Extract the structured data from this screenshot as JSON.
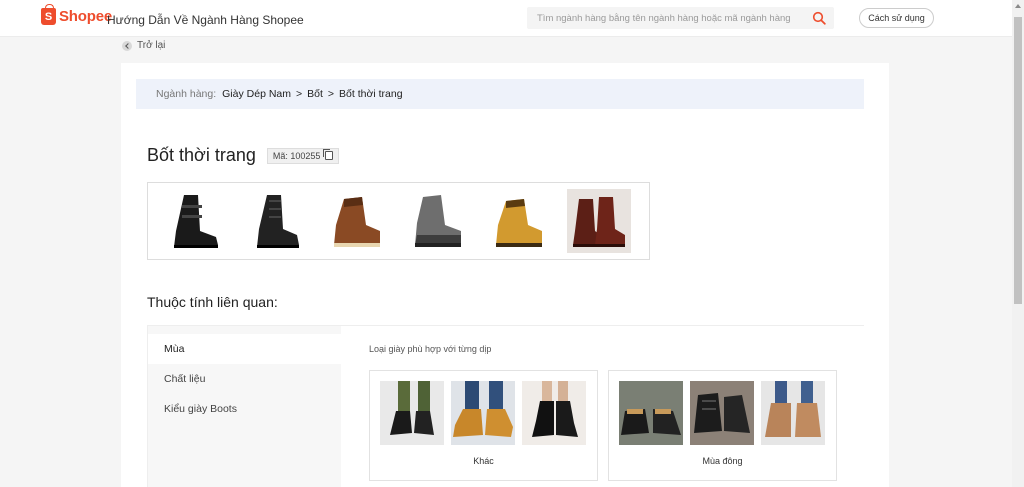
{
  "header": {
    "logo_text": "Shopee",
    "logo_letter": "S",
    "title": "Hướng Dẫn Về Ngành Hàng Shopee",
    "search_placeholder": "Tìm ngành hàng bằng tên ngành hàng hoặc mã ngành hàng",
    "guide_button": "Cách sử dụng"
  },
  "back_label": "Trở lại",
  "breadcrumb": {
    "label": "Ngành hàng:",
    "items": [
      "Giày Dép Nam",
      "Bốt",
      "Bốt thời trang"
    ],
    "separator": ">"
  },
  "category": {
    "title": "Bốt thời trang",
    "code": "Mã: 100255"
  },
  "gallery": [
    "black-buckle-boot",
    "black-lace-up-boot",
    "brown-work-boot",
    "grey-hiking-boot",
    "tan-work-boot",
    "burgundy-dress-boot"
  ],
  "attributes": {
    "title": "Thuộc tính liên quan:",
    "tabs": [
      "Mùa",
      "Chất liệu",
      "Kiểu giày Boots"
    ],
    "active_tab": "Mùa",
    "description": "Loại giày phù hợp với từng dịp",
    "options": [
      {
        "label": "Khác"
      },
      {
        "label": "Mùa đông"
      }
    ]
  },
  "colors": {
    "brand": "#ee4d2d",
    "highlight_border": "#e53935",
    "breadcrumb_bg": "#eef2fa"
  }
}
